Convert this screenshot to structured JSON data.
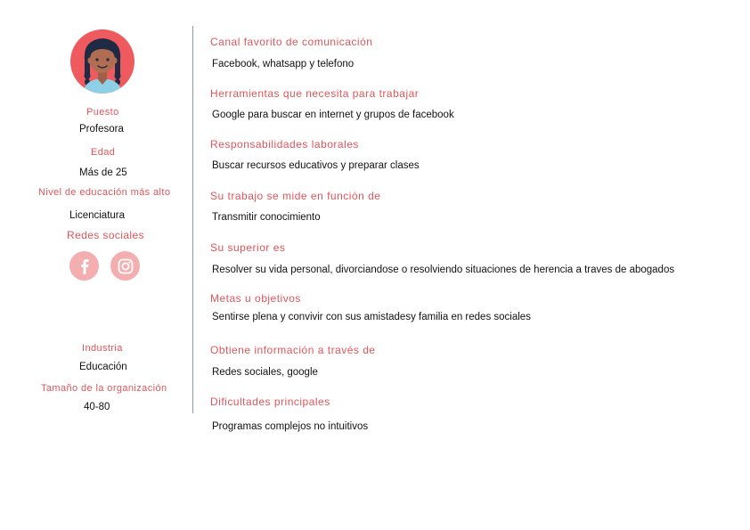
{
  "profile": {
    "puesto_label": "Puesto",
    "puesto_value": "Profesora",
    "edad_label": "Edad",
    "edad_value": "Más de 25",
    "educacion_label": "Nivel de educación más alto",
    "educacion_value": "Licenciatura",
    "redes_label": "Redes sociales",
    "social_icons": [
      "facebook-icon",
      "instagram-icon"
    ],
    "industria_label": "Industria",
    "industria_value": "Educación",
    "tamano_label": "Tamaño de la organización",
    "tamano_value": "40-80"
  },
  "sections": [
    {
      "title": "Canal favorito de comunicación",
      "value": "Facebook, whatsapp y telefono"
    },
    {
      "title": "Herramientas que necesita para trabajar",
      "value": "Google para buscar en internet y grupos de facebook"
    },
    {
      "title": "Responsabilidades laborales",
      "value": "Buscar recursos educativos y preparar clases"
    },
    {
      "title": "Su trabajo se mide en función de",
      "value": "Transmitir conocimiento"
    },
    {
      "title": "Su superior es",
      "value": "Resolver su vida personal, divorciandose o resolviendo situaciones de herencia a traves de abogados"
    },
    {
      "title": "Metas u objetivos",
      "value": "Sentirse plena y convivir con sus amistadesy familia en redes sociales"
    },
    {
      "title": "Obtiene información a través de",
      "value": "Redes sociales, google"
    },
    {
      "title": "Dificultades principales",
      "value": "Programas complejos no intuitivos"
    }
  ],
  "colors": {
    "accent": "#e2545a",
    "avatar_bg": "#ef5a5f",
    "social_bg": "#f5aeb0",
    "divider": "#8a9bb0"
  }
}
